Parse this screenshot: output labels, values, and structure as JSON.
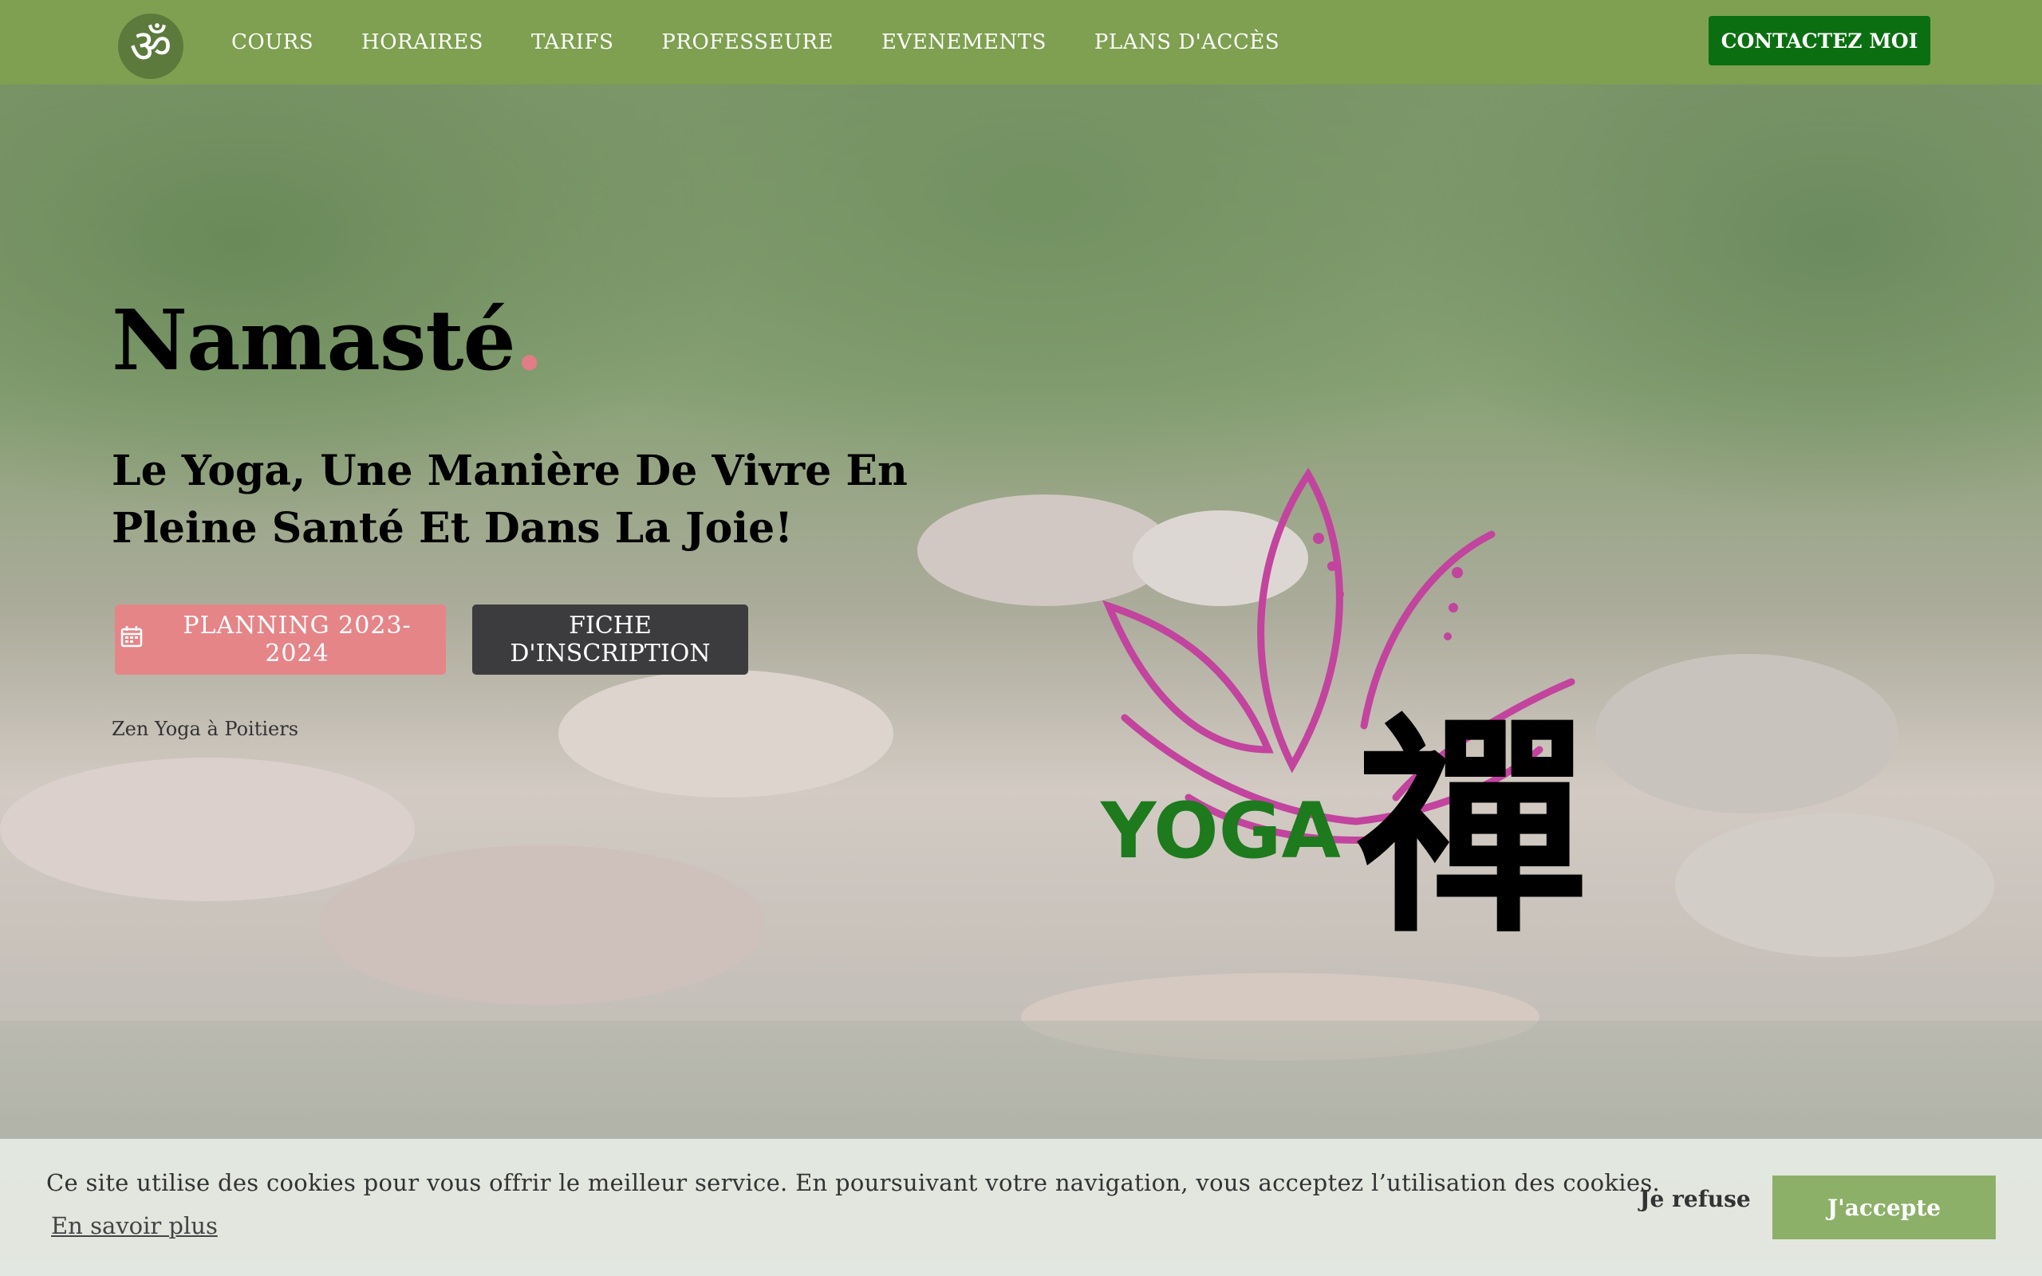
{
  "nav": {
    "logo_symbol": "ॐ",
    "items": [
      {
        "label": "COURS"
      },
      {
        "label": "HORAIRES"
      },
      {
        "label": "TARIFS"
      },
      {
        "label": "PROFESSEURE"
      },
      {
        "label": "EVENEMENTS"
      },
      {
        "label": "PLANS D'ACCÈS"
      }
    ],
    "contact_label": "CONTACTEZ MOI"
  },
  "hero": {
    "title": "Namasté",
    "title_dot": ".",
    "subtitle": "Le Yoga, Une Manière De Vivre En Pleine Santé Et Dans La Joie!",
    "planning_label": "PLANNING 2023-2024",
    "planning_icon": "calendar-icon",
    "inscription_label": "FICHE D'INSCRIPTION",
    "tagline": "Zen Yoga à Poitiers"
  },
  "logo": {
    "text": "YOGA",
    "kanji": "禪"
  },
  "cookie": {
    "message": "Ce site utilise des cookies pour vous offrir le meilleur service. En poursuivant votre navigation, vous acceptez l’utilisation des cookies.",
    "learn_more": "En savoir plus",
    "refuse_label": "Je refuse",
    "accept_label": "J'accepte"
  },
  "colors": {
    "nav_bg": "#7ea050",
    "contact_bg": "#0b6f12",
    "accent_pink": "#e07d86",
    "planning_bg": "#e58588",
    "inscription_bg": "#3c3c3e",
    "accept_bg": "#8cb067",
    "logo_magenta": "#c2449e",
    "logo_green": "#1d7a1d"
  }
}
